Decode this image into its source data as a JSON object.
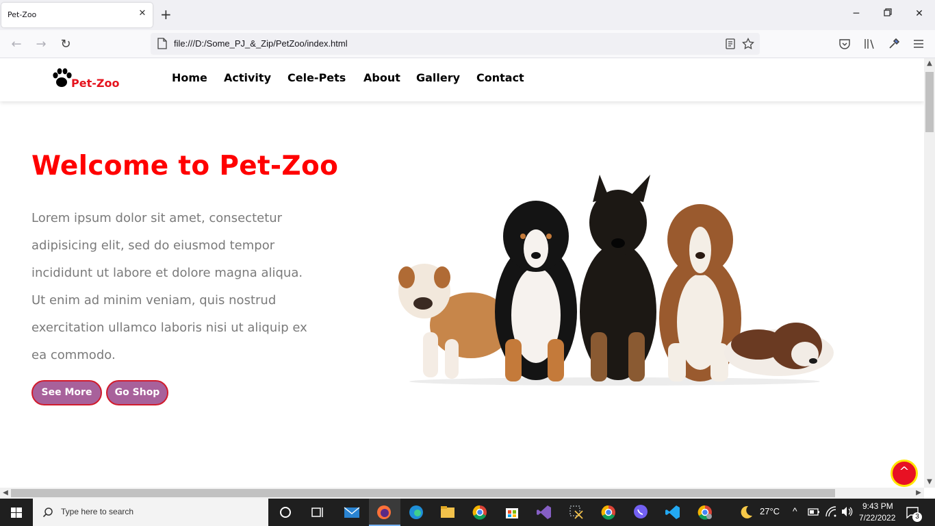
{
  "browser": {
    "tab_title": "Pet-Zoo",
    "url": "file:///D:/Some_PJ_&_Zip/PetZoo/index.html"
  },
  "site": {
    "logo_text": "Pet-Zoo",
    "menu": [
      "Home",
      "Activity",
      "Cele-Pets",
      "About",
      "Gallery",
      "Contact"
    ],
    "hero_title": "Welcome to Pet-Zoo",
    "hero_body": "Lorem ipsum dolor sit amet, consectetur adipisicing elit, sed do eiusmod tempor incididunt ut labore et dolore magna aliqua. Ut enim ad minim veniam, quis nostrud exercitation ullamco laboris nisi ut aliquip ex ea commodo.",
    "buttons": {
      "see_more": "See More",
      "go_shop": "Go Shop"
    },
    "to_top_icon": "^"
  },
  "colors": {
    "accent_red": "#ff0000",
    "button_purple": "#a8619b",
    "body_gray": "#7a7a7a"
  },
  "taskbar": {
    "search_placeholder": "Type here to search",
    "weather": "27°C",
    "time": "9:43 PM",
    "date": "7/22/2022",
    "notifications": "3"
  }
}
